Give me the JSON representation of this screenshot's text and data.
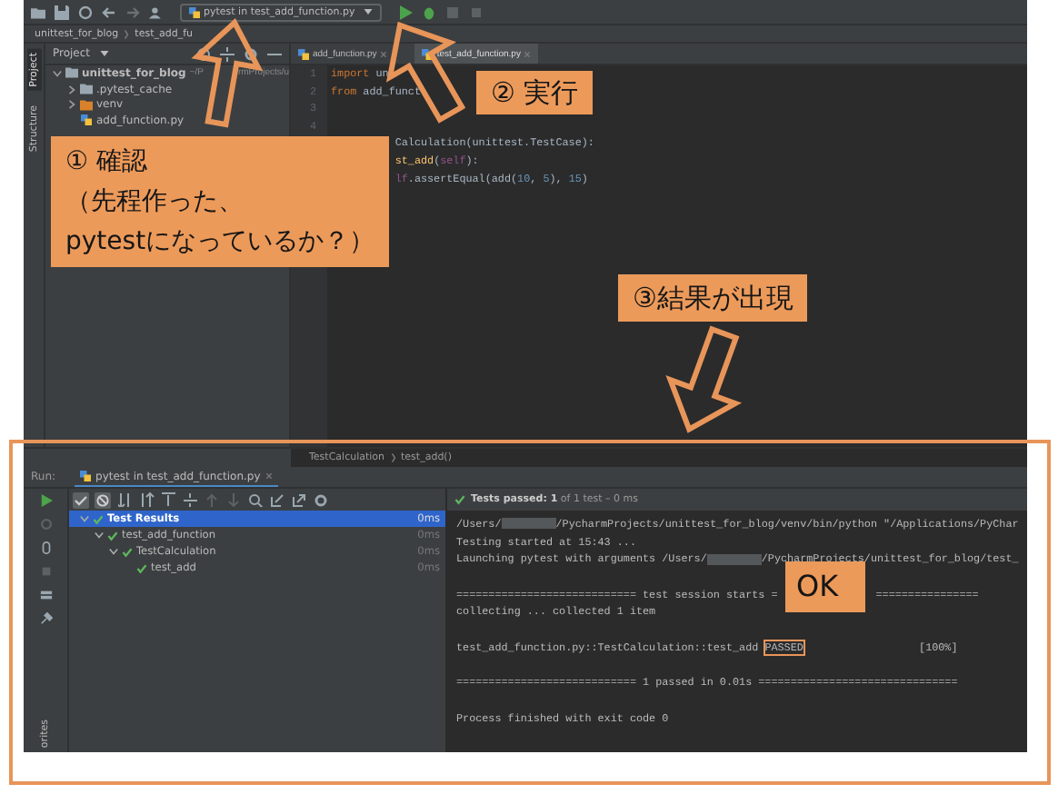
{
  "toolbar": {
    "run_config": "pytest in test_add_function.py"
  },
  "breadcrumbs": [
    "unittest_for_blog",
    "test_add_fu"
  ],
  "side_tabs": [
    {
      "label": "Project",
      "selected": true
    },
    {
      "label": "Structure",
      "selected": false
    }
  ],
  "project_panel": {
    "title": "Project",
    "tree": [
      {
        "name": "unittest_for_blog",
        "path_parts": [
          "~/P",
          "rmProjects/u"
        ],
        "kind": "project",
        "expanded": true,
        "children": [
          {
            "name": ".pytest_cache",
            "kind": "folder",
            "expanded": false
          },
          {
            "name": "venv",
            "kind": "venv",
            "expanded": false
          },
          {
            "name": "add_function.py",
            "kind": "file"
          }
        ]
      }
    ]
  },
  "editor_tabs": [
    {
      "label": "add_function.py",
      "selected": false
    },
    {
      "label": "test_add_function.py",
      "selected": true
    }
  ],
  "code": [
    {
      "number": "1",
      "covered_start": false,
      "segments": [
        {
          "kind": "keyword",
          "text": "import"
        },
        {
          "kind": "plain",
          "text": " un"
        }
      ]
    },
    {
      "number": "2",
      "covered_start": false,
      "segments": [
        {
          "kind": "keyword",
          "text": "from"
        },
        {
          "kind": "plain",
          "text": " add_funct"
        }
      ]
    },
    {
      "number": "3",
      "covered_start": false
    },
    {
      "number": "4",
      "covered_start": false
    },
    {
      "covered_start": true,
      "segments": [
        {
          "kind": "plain",
          "text": "Calculation(unittest.TestCase):"
        }
      ]
    },
    {
      "covered_start": true,
      "segments": [
        {
          "kind": "func",
          "text": "st_add"
        },
        {
          "kind": "plain",
          "text": "("
        },
        {
          "kind": "self",
          "text": "self"
        },
        {
          "kind": "plain",
          "text": "):"
        }
      ]
    },
    {
      "covered_start": true,
      "segments": [
        {
          "kind": "self",
          "text": "lf"
        },
        {
          "kind": "plain",
          "text": ".assertEqual(add("
        },
        {
          "kind": "number",
          "text": "10"
        },
        {
          "kind": "plain",
          "text": ", "
        },
        {
          "kind": "number",
          "text": "5"
        },
        {
          "kind": "plain",
          "text": "), "
        },
        {
          "kind": "number",
          "text": "15"
        },
        {
          "kind": "plain",
          "text": ")"
        }
      ]
    }
  ],
  "editor_breadcrumbs": [
    "TestCalculation",
    "test_add()"
  ],
  "run_panel": {
    "label": "Run:",
    "tab": "pytest in test_add_function.py",
    "status": "**Tests passed: 1** of 1 test – 0 ms",
    "results": [
      {
        "name": "Test Results",
        "time": "0ms",
        "selected": true,
        "expanded": true,
        "children": [
          {
            "name": "test_add_function",
            "time": "0ms",
            "selected": false,
            "expanded": true,
            "children": [
              {
                "name": "TestCalculation",
                "time": "0ms",
                "selected": false,
                "expanded": true,
                "children": [
                  {
                    "name": "test_add",
                    "time": "0ms",
                    "selected": false
                  }
                ]
              }
            ]
          }
        ]
      }
    ],
    "console": [
      {
        "kind": "line",
        "segments": [
          {
            "kind": "text",
            "text": "/Users/"
          },
          {
            "kind": "redacted"
          },
          {
            "kind": "text",
            "text": "/PycharmProjects/unittest_for_blog/venv/bin/python \"/Applications/PyChar"
          }
        ]
      },
      {
        "kind": "line",
        "segments": [
          {
            "kind": "text",
            "text": "Testing started at 15:43 ..."
          }
        ]
      },
      {
        "kind": "line",
        "segments": [
          {
            "kind": "text",
            "text": "Launching pytest with arguments /Users/"
          },
          {
            "kind": "redacted"
          },
          {
            "kind": "text",
            "text": "/PycharmProjects/unittest_for_blog/test_"
          }
        ]
      },
      {
        "kind": "blank"
      },
      {
        "kind": "line",
        "segments": [
          {
            "kind": "text",
            "text": "============================ test session starts ="
          },
          {
            "kind": "gap"
          },
          {
            "kind": "text",
            "text": "================"
          }
        ]
      },
      {
        "kind": "line",
        "segments": [
          {
            "kind": "text",
            "text": "collecting ... collected 1 item"
          }
        ]
      },
      {
        "kind": "blank"
      },
      {
        "kind": "line",
        "segments": [
          {
            "kind": "text",
            "text": "test_add_function.py::TestCalculation::test_add "
          },
          {
            "kind": "passed",
            "text": "PASSED"
          },
          {
            "kind": "text",
            "text": "                  [100%]"
          }
        ]
      },
      {
        "kind": "blank"
      },
      {
        "kind": "line",
        "segments": [
          {
            "kind": "text",
            "text": "============================ 1 passed in 0.01s ==============================="
          }
        ]
      },
      {
        "kind": "blank"
      },
      {
        "kind": "line",
        "segments": [
          {
            "kind": "text",
            "text": "Process finished with exit code 0"
          }
        ]
      }
    ]
  },
  "favorites_tab": "orites",
  "callouts": [
    {
      "lines": [
        "① 確認",
        "（先程作った、",
        "pytestになっているか？）"
      ]
    },
    {
      "lines": [
        "② 実行"
      ]
    },
    {
      "lines": [
        "③結果が出現"
      ]
    },
    {
      "lines": [
        "OK"
      ]
    }
  ]
}
